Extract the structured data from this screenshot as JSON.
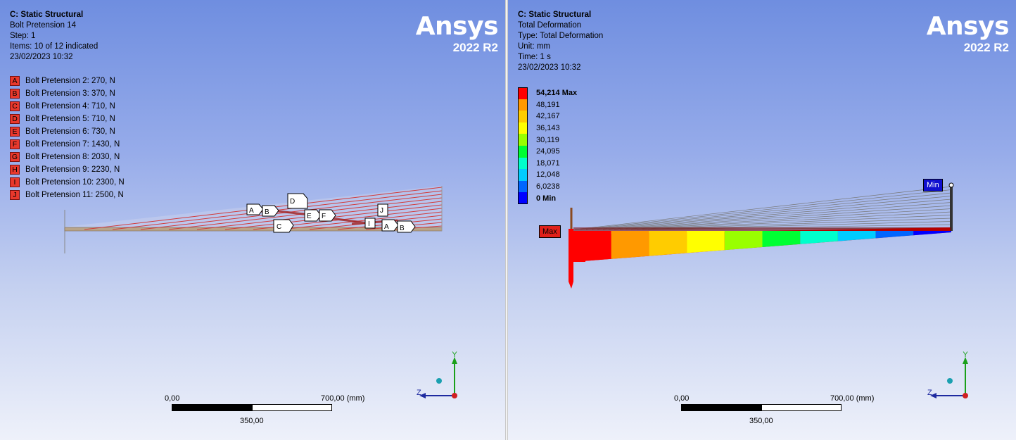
{
  "left": {
    "info": {
      "title": "C: Static Structural",
      "subtitle": "Bolt Pretension 14",
      "step": "Step: 1",
      "items": "Items: 10 of 12 indicated",
      "timestamp": "23/02/2023 10:32"
    },
    "legend": [
      {
        "tag": "A",
        "label": "Bolt Pretension 2: 270, N"
      },
      {
        "tag": "B",
        "label": "Bolt Pretension 3: 370, N"
      },
      {
        "tag": "C",
        "label": "Bolt Pretension 4: 710, N"
      },
      {
        "tag": "D",
        "label": "Bolt Pretension 5: 710, N"
      },
      {
        "tag": "E",
        "label": "Bolt Pretension 6: 730, N"
      },
      {
        "tag": "F",
        "label": "Bolt Pretension 7: 1430, N"
      },
      {
        "tag": "G",
        "label": "Bolt Pretension 8: 2030, N"
      },
      {
        "tag": "H",
        "label": "Bolt Pretension 9: 2230, N"
      },
      {
        "tag": "I",
        "label": "Bolt Pretension 10: 2300, N"
      },
      {
        "tag": "J",
        "label": "Bolt Pretension 11: 2500, N"
      }
    ],
    "scale": {
      "start": "0,00",
      "end": "700,00 (mm)",
      "mid": "350,00"
    },
    "model_tags": [
      "A",
      "B",
      "D",
      "C",
      "E",
      "F",
      "J",
      "I",
      "A",
      "B"
    ]
  },
  "right": {
    "info": {
      "title": "C: Static Structural",
      "subtitle": "Total Deformation",
      "type": "Type: Total Deformation",
      "unit": "Unit: mm",
      "time": "Time: 1 s",
      "timestamp": "23/02/2023 10:32"
    },
    "colorbar": [
      {
        "label": "54,214 Max",
        "color": "#ff0000",
        "bold": true
      },
      {
        "label": "48,191",
        "color": "#ff9900",
        "bold": false
      },
      {
        "label": "42,167",
        "color": "#ffcc00",
        "bold": false
      },
      {
        "label": "36,143",
        "color": "#ffff00",
        "bold": false
      },
      {
        "label": "30,119",
        "color": "#99ff00",
        "bold": false
      },
      {
        "label": "24,095",
        "color": "#00ff33",
        "bold": false
      },
      {
        "label": "18,071",
        "color": "#00ffcc",
        "bold": false
      },
      {
        "label": "12,048",
        "color": "#00ccff",
        "bold": false
      },
      {
        "label": "6,0238",
        "color": "#0066ff",
        "bold": false
      },
      {
        "label": "0 Min",
        "color": "#0000ff",
        "bold": true
      }
    ],
    "max_flag": "Max",
    "min_flag": "Min",
    "scale": {
      "start": "0,00",
      "end": "700,00 (mm)",
      "mid": "350,00"
    }
  },
  "logo": {
    "brand": "Ansys",
    "version": "2022 R2"
  },
  "triad": {
    "y": "Y",
    "z": "Z"
  },
  "colors": {
    "accent_red": "#e8382c",
    "bg_top": "#6f8ee0",
    "bg_bottom": "#eef1fa"
  }
}
